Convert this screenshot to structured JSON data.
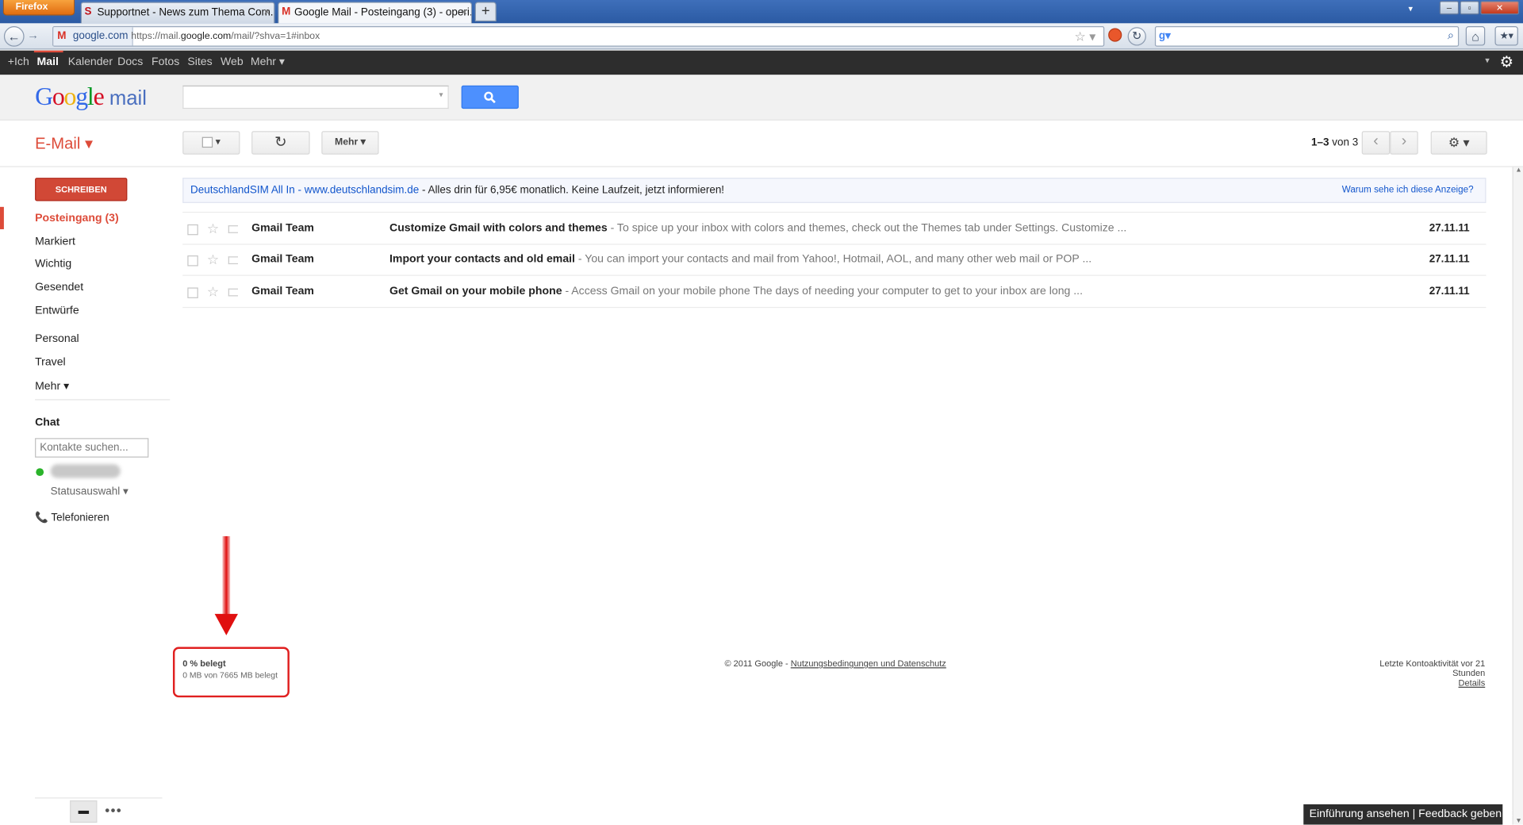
{
  "browser": {
    "menu_button": "Firefox",
    "tabs": [
      {
        "title": "Supportnet - News zum Thema Com...",
        "close": "×"
      },
      {
        "title": "Google Mail - Posteingang (3) - operi...",
        "close": "×"
      }
    ],
    "newtab": "+",
    "url_site": "google.com",
    "url_prefix": "https://mail.",
    "url_domain": "google.com",
    "url_path": "/mail/?shva=1#inbox"
  },
  "gbar": {
    "items": [
      "+Ich",
      "Mail",
      "Kalender",
      "Docs",
      "Fotos",
      "Sites",
      "Web",
      "Mehr ▾"
    ],
    "active_color": "#dd4b39"
  },
  "header": {
    "logo_letters": [
      "G",
      "o",
      "o",
      "g",
      "l",
      "e"
    ],
    "logo_colors": [
      "#3369e8",
      "#d50f25",
      "#eeb211",
      "#3369e8",
      "#009925",
      "#d50f25"
    ],
    "logo_mail": "mail",
    "search_button_icon": "search-icon"
  },
  "toolbar": {
    "email_label": "E-Mail ▾",
    "select_label": "▾",
    "refresh_icon": "↻",
    "more_label": "Mehr ▾",
    "page_range": "1–3",
    "page_of": "von 3",
    "prev": "‹",
    "next": "›",
    "settings": "⚙ ▾"
  },
  "sidebar": {
    "compose": "SCHREIBEN",
    "items": [
      "Posteingang (3)",
      "Markiert",
      "Wichtig",
      "Gesendet",
      "Entwürfe",
      "Personal",
      "Travel",
      "Mehr ▾"
    ],
    "chat_title": "Chat",
    "chat_search_placeholder": "Kontakte suchen...",
    "status_select": "Statusauswahl ▾",
    "phone": "Telefonieren",
    "phone_icon": "📞"
  },
  "ad": {
    "link": "DeutschlandSIM All In - www.deutschlandsim.de",
    "text": " - Alles drin für 6,95€ monatlich. Keine Laufzeit, jetzt informieren!",
    "why": "Warum sehe ich diese Anzeige?"
  },
  "emails": [
    {
      "from": "Gmail Team",
      "subject": "Customize Gmail with colors and themes",
      "snippet": " - To spice up your inbox with colors and themes, check out the Themes tab under Settings. Customize ...",
      "date": "27.11.11"
    },
    {
      "from": "Gmail Team",
      "subject": "Import your contacts and old email",
      "snippet": " - You can import your contacts and mail from Yahoo!, Hotmail, AOL, and many other web mail or POP ...",
      "date": "27.11.11"
    },
    {
      "from": "Gmail Team",
      "subject": "Get Gmail on your mobile phone",
      "snippet": " - Access Gmail on your mobile phone The days of needing your computer to get to your inbox are long ...",
      "date": "27.11.11"
    }
  ],
  "footer": {
    "quota_pct": "0 % belegt",
    "quota_mb": "0 MB von 7665 MB belegt",
    "copyright": "© 2011 Google - ",
    "terms": "Nutzungsbedingungen und Datenschutz",
    "last_activity": "Letzte Kontoaktivität vor 21 Stunden",
    "details": "Details"
  },
  "feedback": "Einführung ansehen | Feedback geben ✕"
}
